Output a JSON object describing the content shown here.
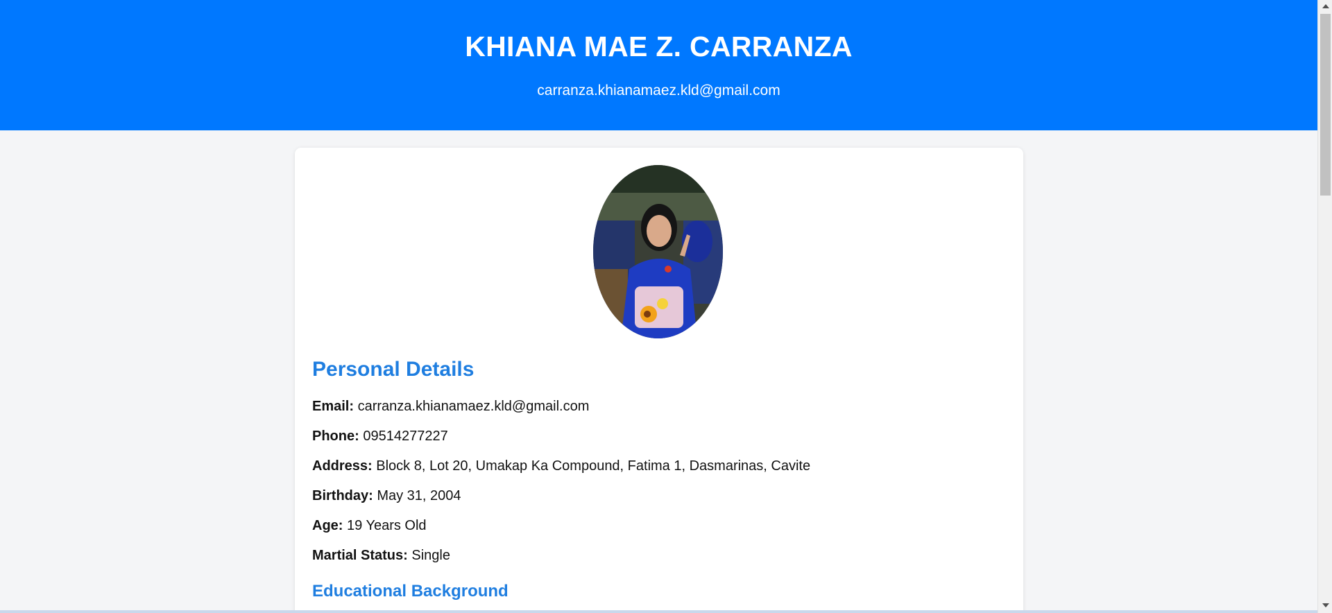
{
  "header": {
    "name": "KHIANA MAE Z. CARRANZA",
    "email": "carranza.khianamaez.kld@gmail.com"
  },
  "profile": {
    "photo_icon": "profile-photo"
  },
  "personal": {
    "title": "Personal Details",
    "fields": [
      {
        "label": "Email:",
        "value": "carranza.khianamaez.kld@gmail.com"
      },
      {
        "label": "Phone:",
        "value": "09514277227"
      },
      {
        "label": "Address:",
        "value": "Block 8, Lot 20, Umakap Ka Compound, Fatima 1, Dasmarinas, Cavite"
      },
      {
        "label": "Birthday:",
        "value": "May 31, 2004"
      },
      {
        "label": "Age:",
        "value": "19 Years Old"
      },
      {
        "label": "Martial Status:",
        "value": "Single"
      }
    ]
  },
  "education": {
    "title": "Educational Background"
  },
  "colors": {
    "header_bg": "#0078ff",
    "section_title": "#1f7ee0",
    "page_bg": "#f4f5f7"
  }
}
